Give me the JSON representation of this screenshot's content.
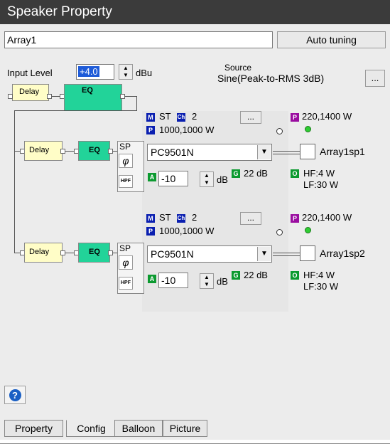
{
  "window": {
    "title": "Speaker Property"
  },
  "array_name": "Array1",
  "auto_tuning_label": "Auto tuning",
  "input": {
    "label": "Input Level",
    "value": "+4.0",
    "unit": "dBu"
  },
  "source": {
    "label": "Source",
    "value": "Sine(Peak-to-RMS 3dB)",
    "browse_label": "..."
  },
  "master_chain": {
    "delay_label": "Delay",
    "eq_label": "EQ"
  },
  "channels": [
    {
      "delay_label": "Delay",
      "eq_label": "EQ",
      "sp_label": "SP",
      "phase_label": "φ",
      "hpf_label": "HPF",
      "mode": "ST",
      "ch_value": "2",
      "browse_label": "...",
      "p_value": "1000,1000 W",
      "speaker_model": "PC9501N",
      "speaker_name": "Array1sp1",
      "attenuation": "-10",
      "att_unit": "dB",
      "gain": "22 dB",
      "power_rating": "220,1400 W",
      "output_hf": "HF:4 W",
      "output_lf": "LF:30 W"
    },
    {
      "delay_label": "Delay",
      "eq_label": "EQ",
      "sp_label": "SP",
      "phase_label": "φ",
      "hpf_label": "HPF",
      "mode": "ST",
      "ch_value": "2",
      "browse_label": "...",
      "p_value": "1000,1000 W",
      "speaker_model": "PC9501N",
      "speaker_name": "Array1sp2",
      "attenuation": "-10",
      "att_unit": "dB",
      "gain": "22 dB",
      "power_rating": "220,1400 W",
      "output_hf": "HF:4 W",
      "output_lf": "LF:30 W"
    }
  ],
  "badges": {
    "m": "M",
    "ch": "Ch",
    "p": "P",
    "a": "A",
    "g": "G",
    "o": "O"
  },
  "help_label": "?",
  "tabs": [
    "Property",
    "Config",
    "Balloon",
    "Picture"
  ],
  "active_tab": "Config",
  "colors": {
    "title_bg": "#3b3b3b",
    "delay": "#fffdc7",
    "eq": "#22d399",
    "badge_blue": "#0a1fb0",
    "badge_green": "#0c9a30",
    "badge_purple": "#9a0da0",
    "input_highlight": "#1e5bd8"
  }
}
